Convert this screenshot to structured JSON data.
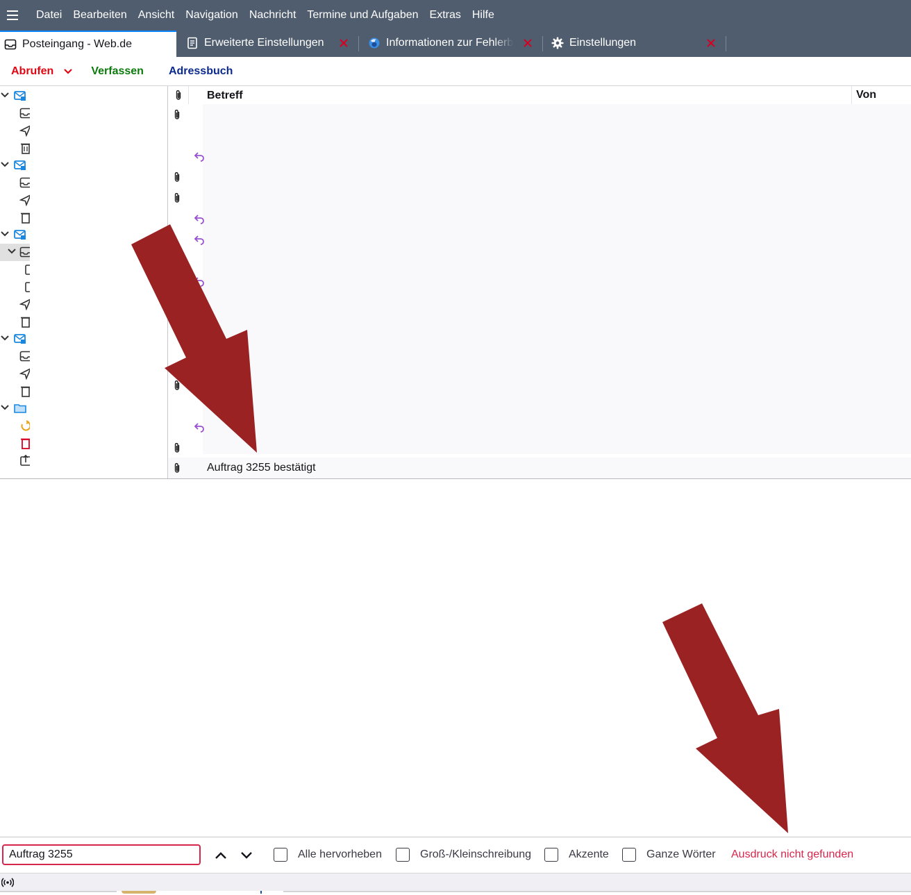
{
  "menubar": {
    "items": [
      {
        "label": "Datei"
      },
      {
        "label": "Bearbeiten"
      },
      {
        "label": "Ansicht"
      },
      {
        "label": "Navigation"
      },
      {
        "label": "Nachricht"
      },
      {
        "label": "Termine und Aufgaben"
      },
      {
        "label": "Extras"
      },
      {
        "label": "Hilfe"
      }
    ]
  },
  "tabs": [
    {
      "label": "Posteingang - Web.de",
      "icon": "inbox-icon",
      "active": true
    },
    {
      "label": "Erweiterte Einstellungen",
      "icon": "document-icon"
    },
    {
      "label": "Informationen zur Fehlerb",
      "icon": "firefox-icon"
    },
    {
      "label": "Einstellungen",
      "icon": "gear-icon"
    }
  ],
  "toolbar": {
    "get_mail": "Abrufen",
    "compose": "Verfassen",
    "address_book": "Adressbuch"
  },
  "thread_columns": {
    "subject": "Betreff",
    "from": "Von"
  },
  "thread_rows": [
    {
      "subject": "Auftrag 3255 bestätigt",
      "attachment": true
    }
  ],
  "findbar": {
    "query": "Auftrag 3255",
    "highlight_all": "Alle hervorheben",
    "match_case": "Groß-/Kleinschreibung",
    "diacritics": "Akzente",
    "whole_words": "Ganze Wörter",
    "status": "Ausdruck nicht gefunden"
  },
  "colors": {
    "menubar": "#505d6e",
    "get_mail": "#e30613",
    "compose": "#0d7a0d",
    "address_book": "#0c2a8c",
    "find_error": "#d7264c",
    "annotation_arrow": "#9b2222",
    "reply_icon": "#9a4fd0"
  }
}
